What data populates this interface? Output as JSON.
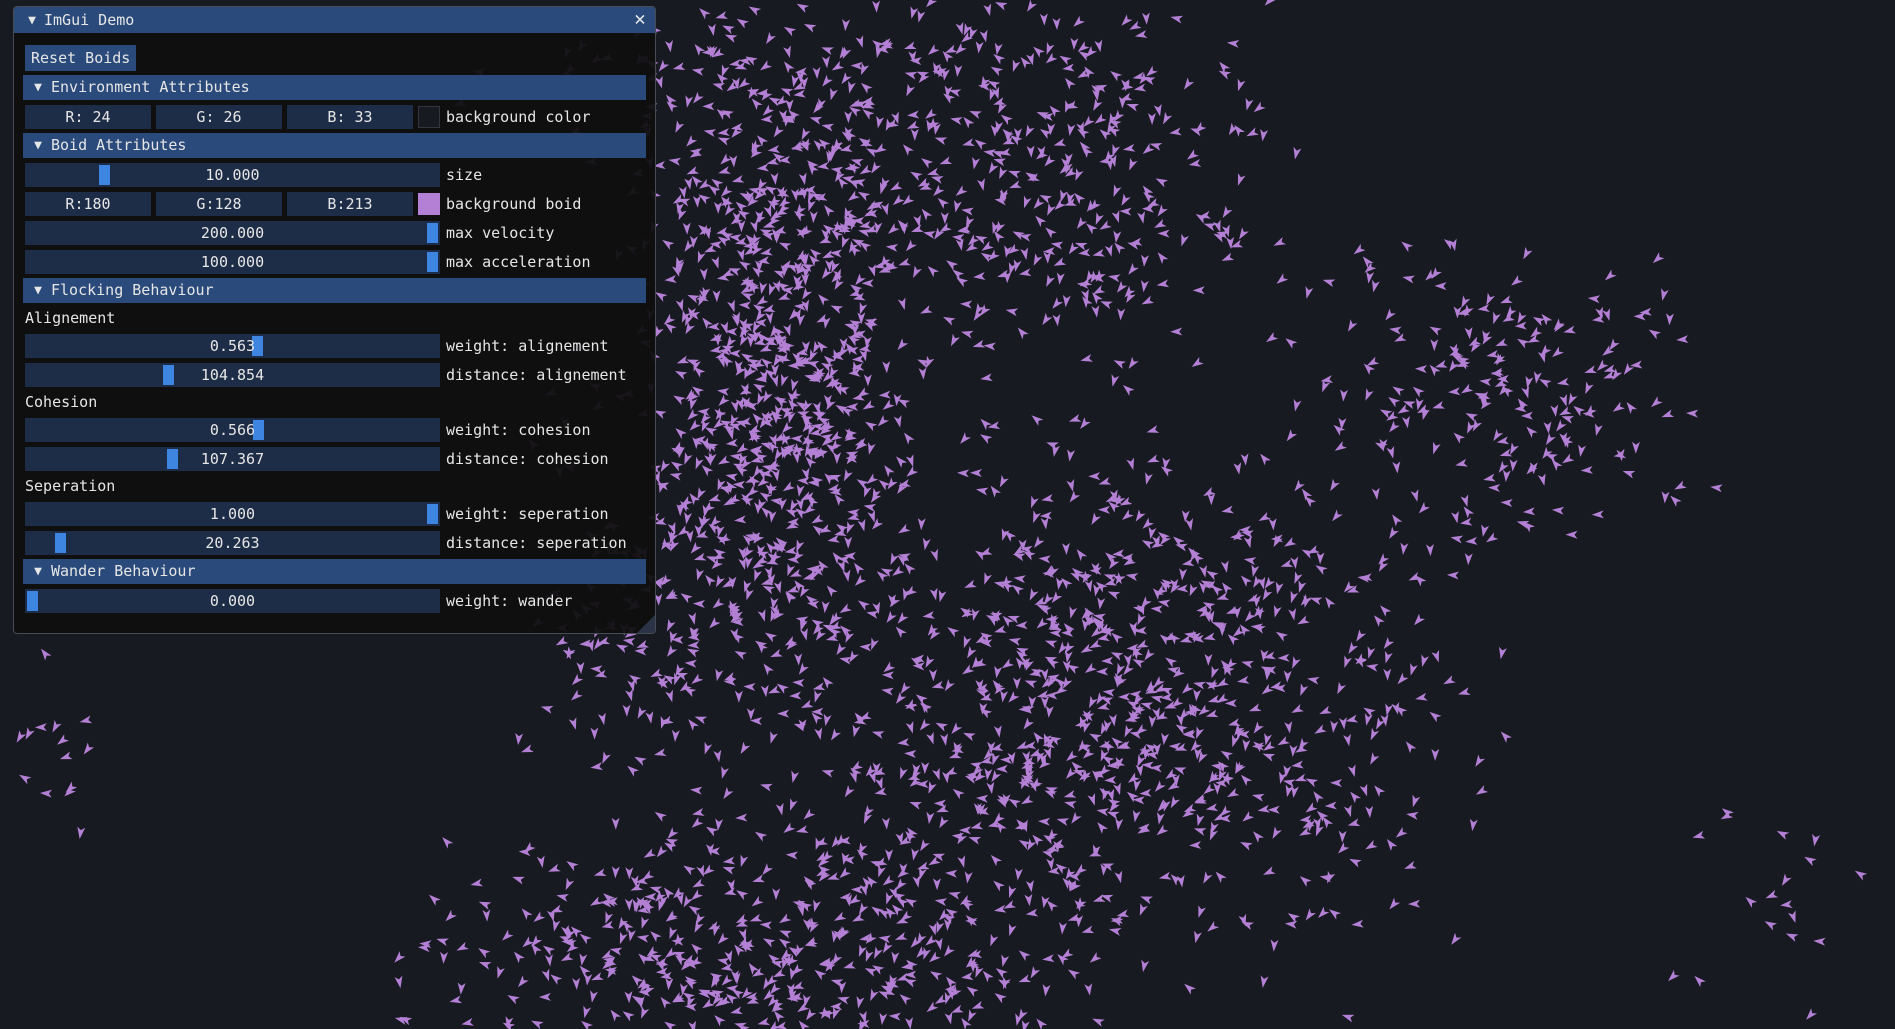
{
  "window": {
    "title": "ImGui Demo"
  },
  "buttons": {
    "reset": "Reset Boids"
  },
  "sections": {
    "environment": "Environment Attributes",
    "boid": "Boid Attributes",
    "flocking": "Flocking Behaviour",
    "wander": "Wander Behaviour"
  },
  "environment": {
    "r": "R: 24",
    "g": "G: 26",
    "b": "B: 33",
    "label": "background color",
    "swatch_color": "#181a21"
  },
  "boid": {
    "size": {
      "value": "10.000",
      "label": "size",
      "fraction": 0.18
    },
    "r": "R:180",
    "g": "G:128",
    "b": "B:213",
    "color_label": "background boid",
    "swatch_color": "#b480d5",
    "max_velocity": {
      "value": "200.000",
      "label": "max velocity",
      "fraction": 1.0
    },
    "max_acceleration": {
      "value": "100.000",
      "label": "max acceleration",
      "fraction": 1.0
    }
  },
  "flocking": {
    "alignment_title": "Alignement",
    "weight_alignment": {
      "value": "0.563",
      "label": "weight: alignement",
      "fraction": 0.563
    },
    "distance_alignment": {
      "value": "104.854",
      "label": "distance: alignement",
      "fraction": 0.34
    },
    "cohesion_title": "Cohesion",
    "weight_cohesion": {
      "value": "0.566",
      "label": "weight: cohesion",
      "fraction": 0.566
    },
    "distance_cohesion": {
      "value": "107.367",
      "label": "distance: cohesion",
      "fraction": 0.35
    },
    "separation_title": "Seperation",
    "weight_separation": {
      "value": "1.000",
      "label": "weight: seperation",
      "fraction": 1.0
    },
    "distance_separation": {
      "value": "20.263",
      "label": "distance: seperation",
      "fraction": 0.07
    }
  },
  "wander": {
    "weight_wander": {
      "value": "0.000",
      "label": "weight: wander",
      "fraction": 0.0
    }
  },
  "boid_color": "#b480d5",
  "accent": "#3d85e0",
  "icons": {
    "collapse": "triangle-down-icon",
    "close": "close-icon"
  }
}
